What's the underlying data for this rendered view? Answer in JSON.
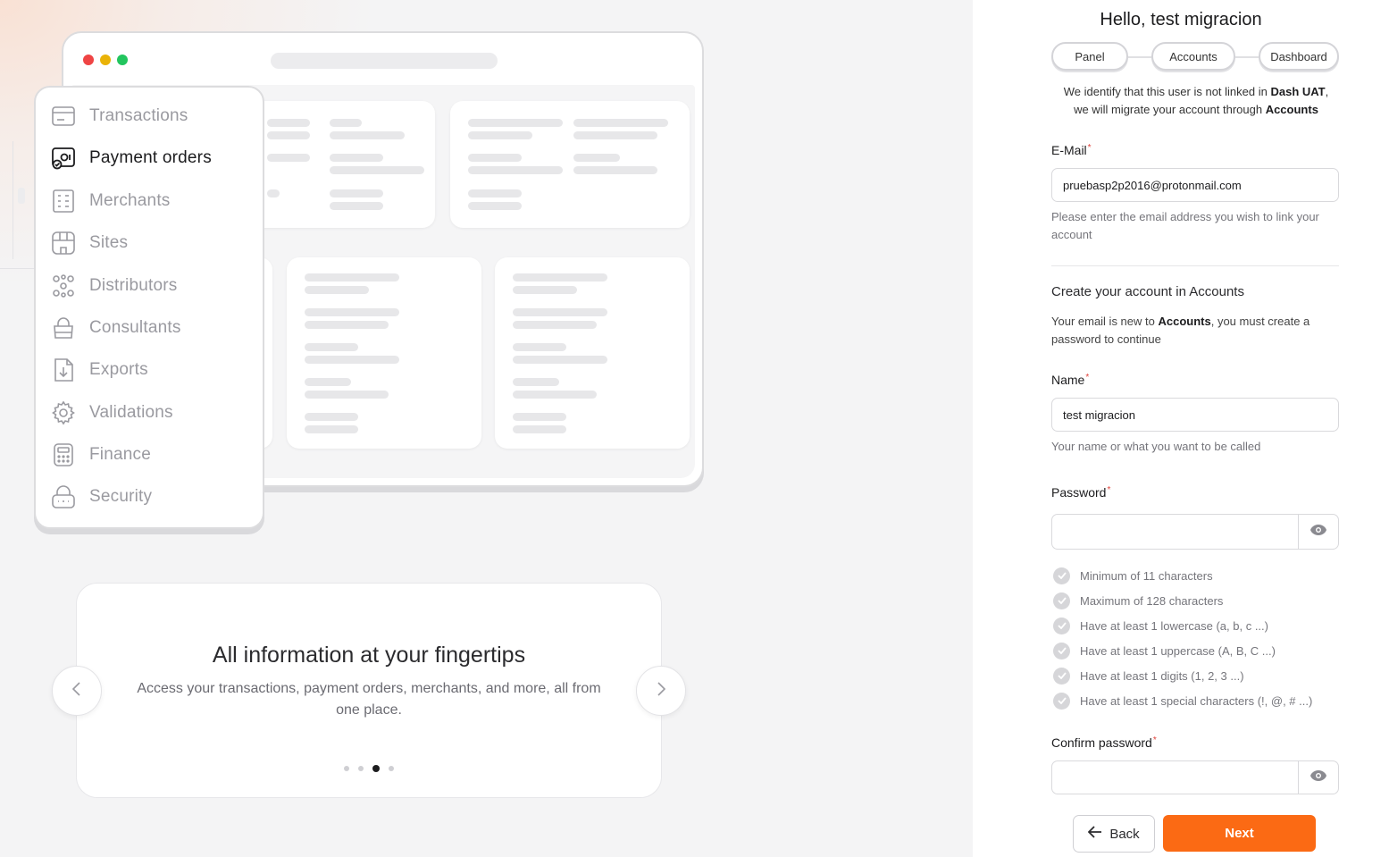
{
  "colors": {
    "accent": "#fb6a14",
    "required": "#e0413a",
    "window_red": "#ef4444",
    "window_yellow": "#eab308",
    "window_green": "#22c55e"
  },
  "illustration": {
    "menu_items": [
      {
        "label": "Transactions",
        "icon": "card-icon",
        "active": false
      },
      {
        "label": "Payment orders",
        "icon": "payment-order-icon",
        "active": true
      },
      {
        "label": "Merchants",
        "icon": "merchants-icon",
        "active": false
      },
      {
        "label": "Sites",
        "icon": "store-icon",
        "active": false
      },
      {
        "label": "Distributors",
        "icon": "distributors-icon",
        "active": false
      },
      {
        "label": "Consultants",
        "icon": "bag-icon",
        "active": false
      },
      {
        "label": "Exports",
        "icon": "export-file-icon",
        "active": false
      },
      {
        "label": "Validations",
        "icon": "gear-icon",
        "active": false
      },
      {
        "label": "Finance",
        "icon": "calculator-icon",
        "active": false
      },
      {
        "label": "Security",
        "icon": "lock-icon",
        "active": false
      }
    ]
  },
  "carousel": {
    "title": "All information at your fingertips",
    "description": "Access your transactions, payment orders, merchants, and more, all from one place.",
    "slide_count": 4,
    "active_slide": 3,
    "prev_icon": "chevron-left-icon",
    "next_icon": "chevron-right-icon"
  },
  "form": {
    "greeting": "Hello, test migracion",
    "steps": [
      "Panel",
      "Accounts",
      "Dashboard"
    ],
    "intro": {
      "text_1": "We identify that this user is not linked in ",
      "bold_1": "Dash UAT",
      "text_2": ",",
      "text_3": "we will migrate your account through ",
      "bold_2": "Accounts"
    },
    "email": {
      "label": "E-Mail",
      "required_mark": "*",
      "value": "pruebasp2p2016@protonmail.com",
      "hint": "Please enter the email address you wish to link your account"
    },
    "section": {
      "title": "Create your account in Accounts",
      "desc_1": "Your email is new to ",
      "desc_bold": "Accounts",
      "desc_2": ", you must create a password to continue"
    },
    "name": {
      "label": "Name",
      "required_mark": "*",
      "value": "test migracion",
      "hint": "Your name or what you want to be called"
    },
    "password": {
      "label": "Password",
      "required_mark": "*",
      "value": "",
      "toggle_icon": "eye-icon"
    },
    "rules": [
      "Minimum of 11 characters",
      "Maximum of 128 characters",
      "Have at least 1 lowercase (a, b, c ...)",
      "Have at least 1 uppercase (A, B, C ...)",
      "Have at least 1 digits (1, 2, 3 ...)",
      "Have at least 1 special characters (!, @, # ...)"
    ],
    "confirm_password": {
      "label": "Confirm password",
      "required_mark": "*",
      "value": "",
      "toggle_icon": "eye-icon"
    },
    "back_label": "Back",
    "next_label": "Next"
  }
}
